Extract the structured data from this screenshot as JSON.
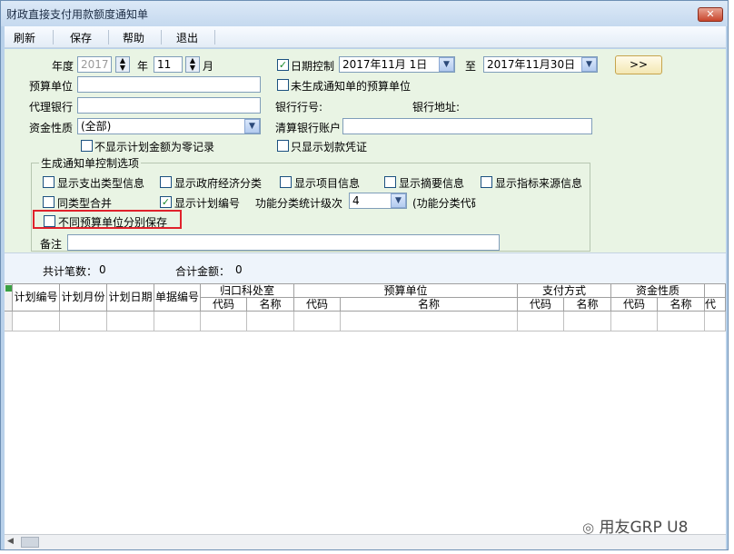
{
  "window": {
    "title": "财政直接支付用款额度通知单",
    "close_label": "✕"
  },
  "toolbar": {
    "refresh": "刷新",
    "save": "保存",
    "help": "帮助",
    "exit": "退出"
  },
  "form": {
    "year_label": "年度",
    "year_value": "2017",
    "month_label": "年",
    "month_value": "11",
    "month_suffix": "月",
    "date_control_label": "日期控制",
    "date_from": "2017年11月 1日",
    "to_label": "至",
    "date_to": "2017年11月30日",
    "go_label": ">>",
    "budget_unit_label": "预算单位",
    "not_generated_label": "未生成通知单的预算单位",
    "agent_bank_label": "代理银行",
    "bank_code_label": "银行行号:",
    "bank_addr_label": "银行地址:",
    "fund_nature_label": "资金性质",
    "fund_nature_value": "(全部)",
    "clearing_account_label": "清算银行账户",
    "hide_zero_label": "不显示计划金额为零记录",
    "only_transfer_label": "只显示划款凭证"
  },
  "options": {
    "group_title": "生成通知单控制选项",
    "show_expense_type": "显示支出类型信息",
    "show_gov_econ": "显示政府经济分类",
    "show_project": "显示项目信息",
    "show_summary": "显示摘要信息",
    "show_indicator_source": "显示指标来源信息",
    "merge_same_type": "同类型合并",
    "show_plan_no": "显示计划编号",
    "func_level_label": "功能分类统计级次",
    "func_level_value": "4",
    "func_code_label": "(功能分类代码",
    "separate_save": "不同预算单位分别保存",
    "remark_label": "备注"
  },
  "summary": {
    "count_label": "共计笔数：",
    "count_value": "0",
    "total_label": "合计金额：",
    "total_value": "0"
  },
  "grid": {
    "columns_top": [
      "计划编号",
      "计划月份",
      "计划日期",
      "单据编号",
      "归口科处室",
      "预算单位",
      "支付方式",
      "资金性质"
    ],
    "columns_sub": [
      "代码",
      "名称",
      "代码",
      "名称",
      "代码",
      "名称",
      "代码",
      "名称",
      "代"
    ]
  },
  "watermark": "用友GRP U8",
  "colors": {
    "window_bg": "#b9d1ea",
    "panel_bg": "#e9f4e4",
    "highlight": "#e0212b"
  }
}
